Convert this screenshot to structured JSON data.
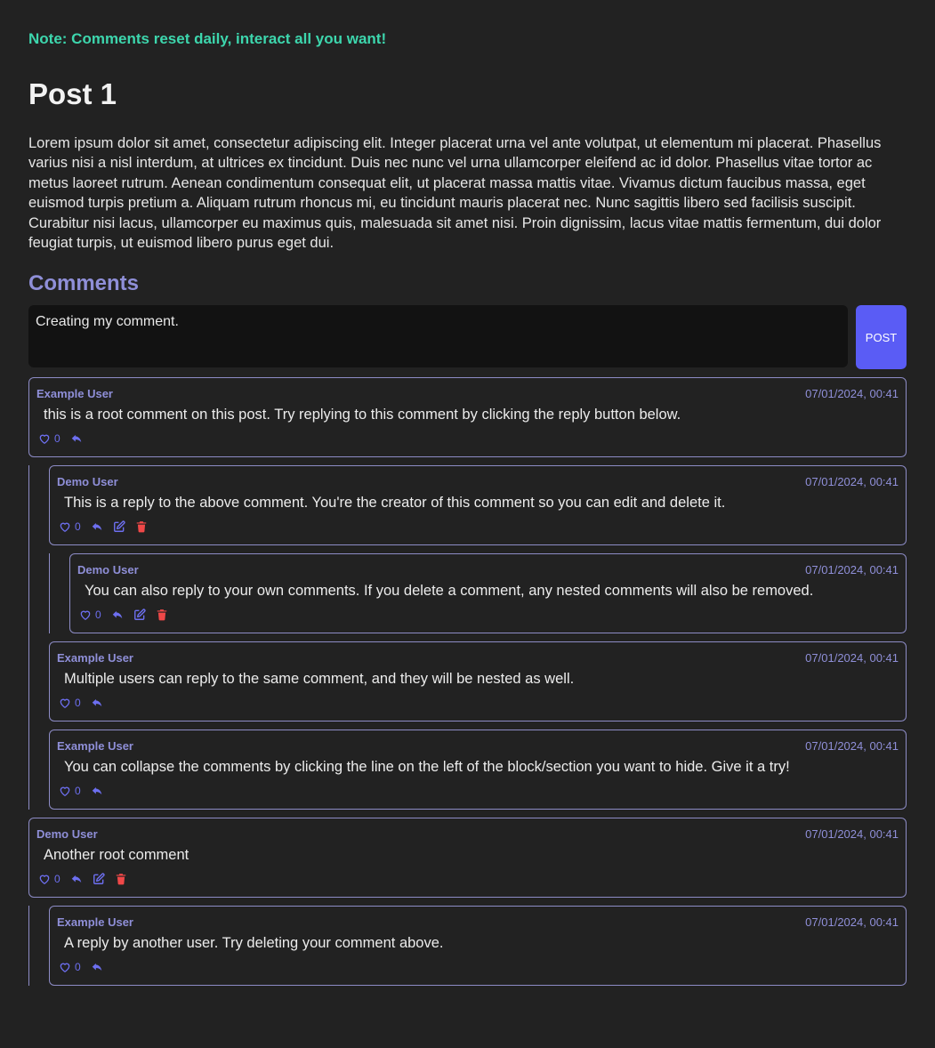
{
  "note": "Note: Comments reset daily, interact all you want!",
  "post": {
    "title": "Post 1",
    "body": "Lorem ipsum dolor sit amet, consectetur adipiscing elit. Integer placerat urna vel ante volutpat, ut elementum mi placerat. Phasellus varius nisi a nisl interdum, at ultrices ex tincidunt. Duis nec nunc vel urna ullamcorper eleifend ac id dolor. Phasellus vitae tortor ac metus laoreet rutrum. Aenean condimentum consequat elit, ut placerat massa mattis vitae. Vivamus dictum faucibus massa, eget euismod turpis pretium a. Aliquam rutrum rhoncus mi, eu tincidunt mauris placerat nec. Nunc sagittis libero sed facilisis suscipit. Curabitur nisi lacus, ullamcorper eu maximus quis, malesuada sit amet nisi. Proin dignissim, lacus vitae mattis fermentum, dui dolor feugiat turpis, ut euismod libero purus eget dui."
  },
  "comments_heading": "Comments",
  "composer": {
    "value": "Creating my comment.",
    "post_label": "POST"
  },
  "icons": {
    "like": "heart-outline-icon",
    "reply": "reply-arrow-icon",
    "edit": "edit-icon",
    "delete": "trash-icon"
  },
  "colors": {
    "accent": "#5a5cf5",
    "note": "#3dd6ad",
    "border": "#8d8cc6",
    "delete": "#f04848"
  },
  "comments": [
    {
      "author": "Example User",
      "date": "07/01/2024, 00:41",
      "text": "this is a root comment on this post. Try replying to this comment by clicking the reply button below.",
      "likes": "0",
      "own": false,
      "replies": [
        {
          "author": "Demo User",
          "date": "07/01/2024, 00:41",
          "text": "This is a reply to the above comment. You're the creator of this comment so you can edit and delete it.",
          "likes": "0",
          "own": true,
          "replies": [
            {
              "author": "Demo User",
              "date": "07/01/2024, 00:41",
              "text": "You can also reply to your own comments. If you delete a comment, any nested comments will also be removed.",
              "likes": "0",
              "own": true,
              "replies": []
            }
          ]
        },
        {
          "author": "Example User",
          "date": "07/01/2024, 00:41",
          "text": "Multiple users can reply to the same comment, and they will be nested as well.",
          "likes": "0",
          "own": false,
          "replies": []
        },
        {
          "author": "Example User",
          "date": "07/01/2024, 00:41",
          "text": "You can collapse the comments by clicking the line on the left of the block/section you want to hide. Give it a try!",
          "likes": "0",
          "own": false,
          "replies": []
        }
      ]
    },
    {
      "author": "Demo User",
      "date": "07/01/2024, 00:41",
      "text": "Another root comment",
      "likes": "0",
      "own": true,
      "replies": [
        {
          "author": "Example User",
          "date": "07/01/2024, 00:41",
          "text": "A reply by another user. Try deleting your comment above.",
          "likes": "0",
          "own": false,
          "replies": []
        }
      ]
    }
  ]
}
